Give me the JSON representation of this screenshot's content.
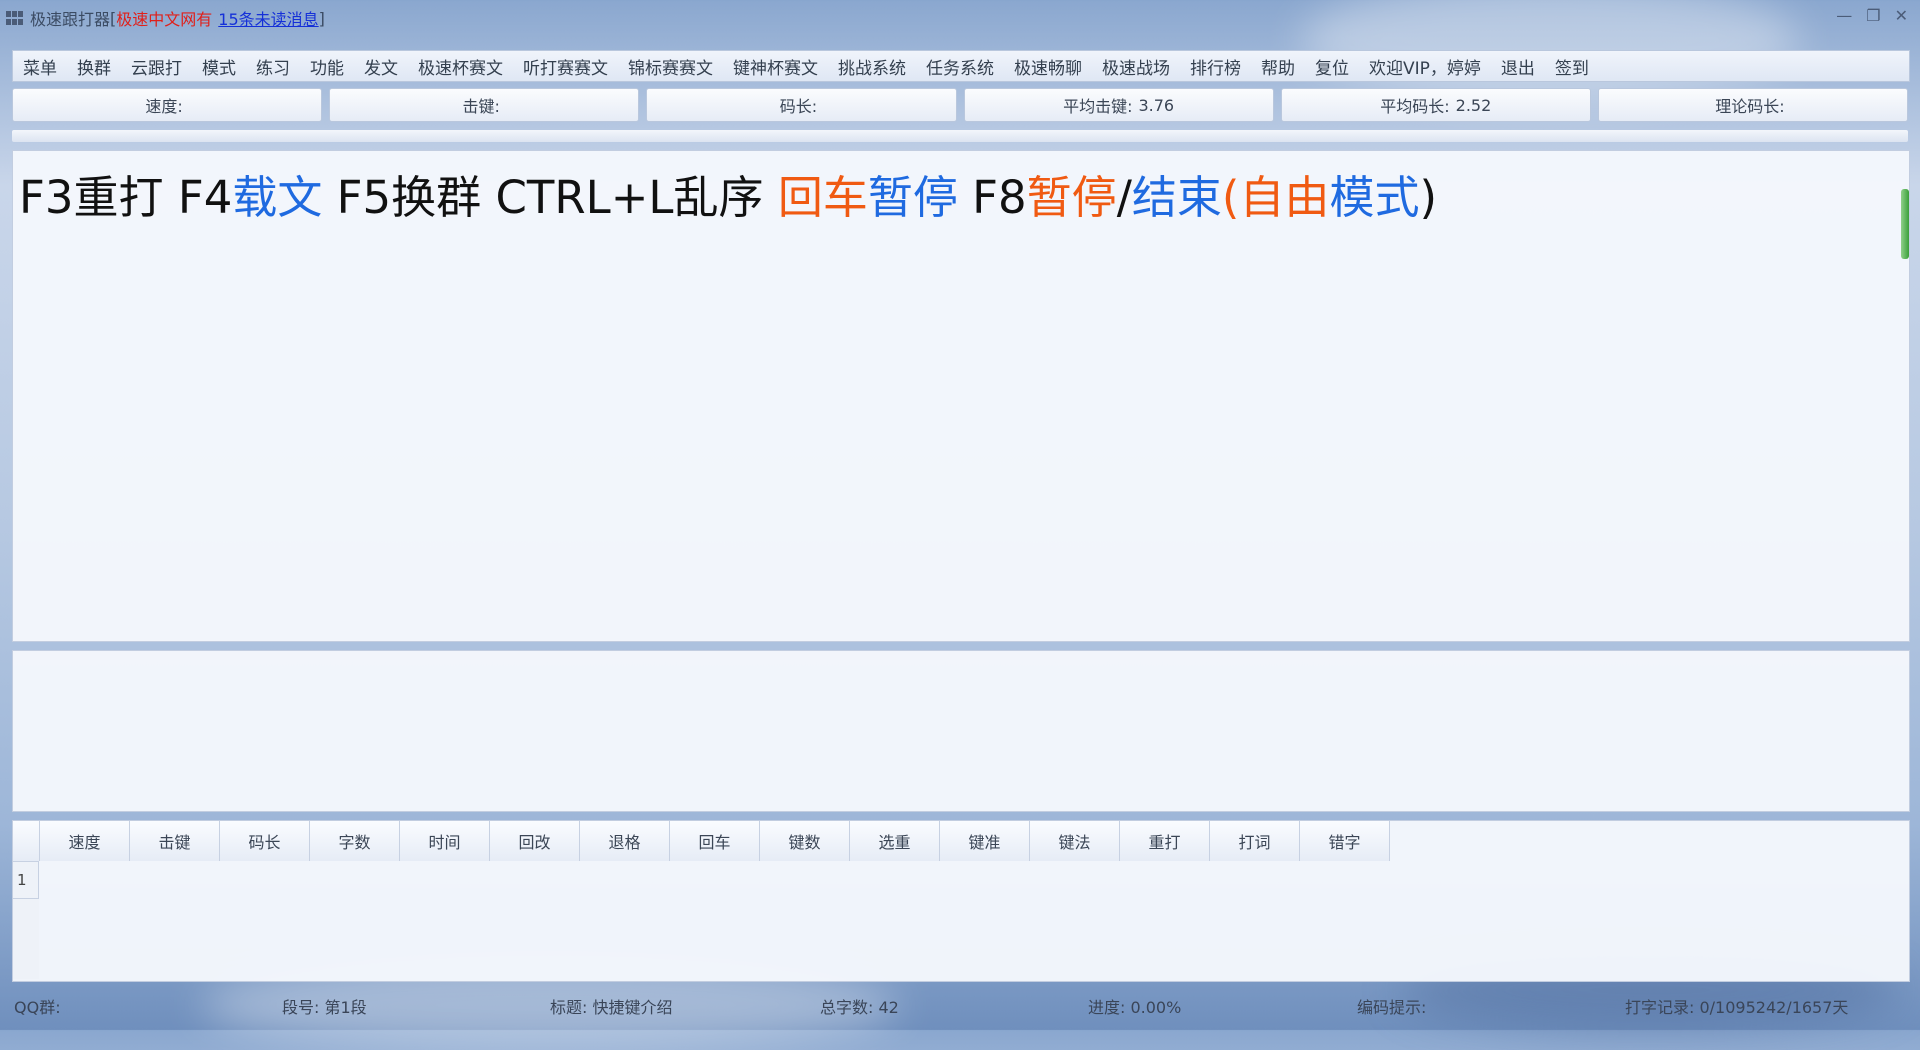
{
  "titlebar": {
    "app_name": "极速跟打器",
    "red_text": "极速中文网有",
    "link_text": "15条未读消息",
    "minimize": "—",
    "restore": "❐",
    "close": "✕"
  },
  "menu": [
    "菜单",
    "换群",
    "云跟打",
    "模式",
    "练习",
    "功能",
    "发文",
    "极速杯赛文",
    "听打赛赛文",
    "锦标赛赛文",
    "键神杯赛文",
    "挑战系统",
    "任务系统",
    "极速畅聊",
    "极速战场",
    "排行榜",
    "帮助",
    "复位",
    "欢迎VIP，婷婷",
    "退出",
    "签到"
  ],
  "stats": [
    {
      "label": "速度:",
      "value": ""
    },
    {
      "label": "击键:",
      "value": ""
    },
    {
      "label": "码长:",
      "value": ""
    },
    {
      "label": "平均击键:",
      "value": "3.76"
    },
    {
      "label": "平均码长:",
      "value": "2.52"
    },
    {
      "label": "理论码长:",
      "value": ""
    }
  ],
  "hint": {
    "p1": "F3重打 F4",
    "p2": "载文",
    "p3": " F5换群 CTRL+L乱序 ",
    "p4": "回车",
    "p5": "暂停",
    "p6": " F8",
    "p7": "暂停",
    "p8": "/",
    "p9": "结束",
    "p10": "(",
    "p11": "自由",
    "p12": "模式",
    "p13": ")"
  },
  "table": {
    "headers": [
      "速度",
      "击键",
      "码长",
      "字数",
      "时间",
      "回改",
      "退格",
      "回车",
      "键数",
      "选重",
      "键准",
      "键法",
      "重打",
      "打词",
      "错字"
    ],
    "row_number": "1"
  },
  "status": {
    "qq": "QQ群:",
    "segment": "段号: 第1段",
    "title": "标题: 快捷键介绍",
    "total": "总字数: 42",
    "progress": "进度: 0.00%",
    "encoding": "编码提示:",
    "record": "打字记录: 0/1095242/1657天"
  },
  "colors": {
    "accent_orange": "#f05a12",
    "accent_blue": "#1f6ae0",
    "title_red": "#e0201a",
    "link_blue": "#1530d8"
  }
}
